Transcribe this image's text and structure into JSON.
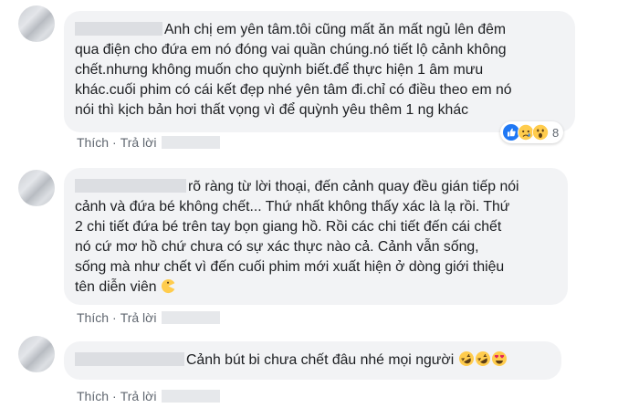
{
  "comments": [
    {
      "lines": [
        "Anh chị em yên tâm.tôi cũng mất ăn mất ngủ lên đêm",
        "qua điện cho đứa em nó đóng vai quần chúng.nó tiết lộ cảnh không",
        "chết.nhưng không muốn cho quỳnh biết.để thực hiện 1 âm mưu",
        "khác.cuối phim có cái kết đẹp nhé yên tâm đi.chỉ có điều theo em nó",
        "nói thì kịch bản hơi thất vọng vì để quỳnh yêu thêm 1 ng khác"
      ],
      "like_label": "Thích",
      "reply_label": "Trả lời",
      "reactions": {
        "icons": [
          "like-reaction",
          "sad-reaction",
          "wow-reaction"
        ],
        "count": "8"
      }
    },
    {
      "lines": [
        "rõ ràng từ lời thoại, đến cảnh quay đều gián tiếp nói",
        "cảnh và đứa bé không chết... Thứ nhất không thấy xác là lạ rồi. Thứ",
        "2 chi tiết đứa bé trên tay bọn giang hồ. Rồi các chi tiết đến cái chết",
        "nó cứ mơ hồ chứ chưa có sự xác thực nào cả. Cảnh vẫn sống,",
        "sống mà như chết vì đến cuối phim mới xuất hiện ở dòng giới thiệu",
        "tên diễn viên"
      ],
      "trailing_icon": "pacman-emoji",
      "like_label": "Thích",
      "reply_label": "Trả lời"
    },
    {
      "lines": [
        "Cảnh bút bi chưa chết đâu nhé mọi người"
      ],
      "trailing_icons": [
        "rofl-emoji",
        "rofl-emoji",
        "heart-eyes-emoji"
      ],
      "like_label": "Thích",
      "reply_label": "Trả lời"
    }
  ],
  "colors": {
    "bubble": "#f2f3f5",
    "text": "#1c1e21",
    "meta": "#606770",
    "like_blue": "#2078f4",
    "emoji_yellow": "#ffcc4d"
  }
}
